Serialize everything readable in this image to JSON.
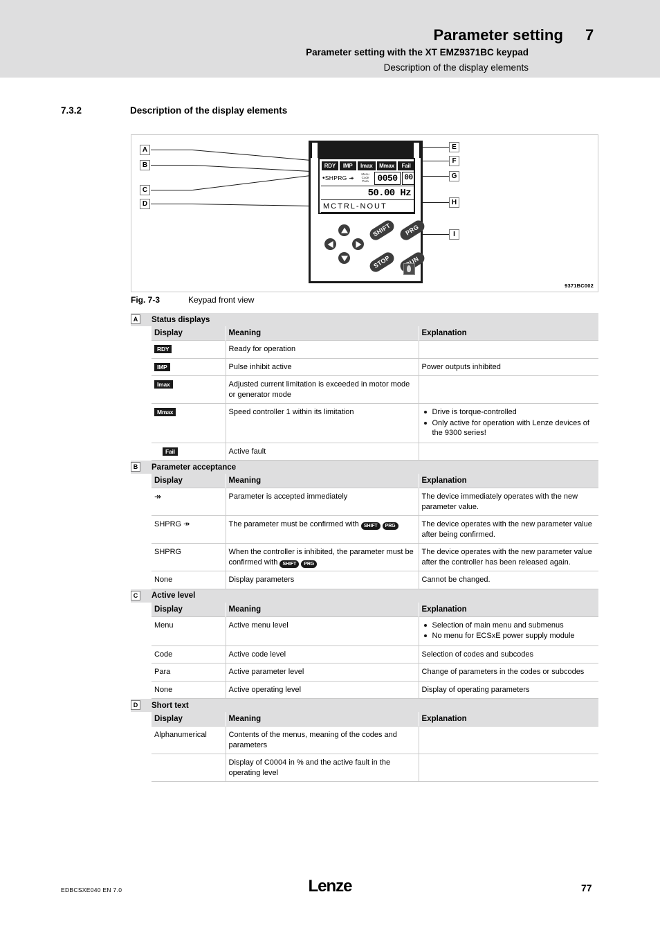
{
  "header": {
    "title": "Parameter setting",
    "chapter": "7",
    "sub1": "Parameter setting with the XT EMZ9371BC keypad",
    "sub2": "Description of the display elements"
  },
  "section": {
    "number": "7.3.2",
    "title": "Description of the display elements"
  },
  "figure": {
    "code": "9371BC002",
    "caption_label": "Fig. 7-3",
    "caption_text": "Keypad front view",
    "callouts": [
      "A",
      "B",
      "C",
      "D",
      "E",
      "F",
      "G",
      "H",
      "I"
    ],
    "keypad": {
      "status_chips": [
        "RDY",
        "IMP",
        "Imax",
        "Mmax",
        "Fail"
      ],
      "param_accept": "SHPRG",
      "param_accept_arrow": "↠",
      "levels": [
        "Menu",
        "Code",
        "Para"
      ],
      "code_value": "0050",
      "subcode_value": "00",
      "value": "50.00",
      "unit": "Hz",
      "short_text": "MCTRL-NOUT",
      "keys": [
        "SHIFT",
        "PRG",
        "STOP",
        "RUN"
      ],
      "arrow_keys": [
        "up",
        "down",
        "left",
        "right"
      ]
    }
  },
  "tables": [
    {
      "marker": "A",
      "title": "Status displays",
      "columns": [
        "Display",
        "Meaning",
        "Explanation"
      ],
      "rows": [
        {
          "display_badge": "RDY",
          "meaning": "Ready for operation",
          "explanation": ""
        },
        {
          "display_badge": "IMP",
          "meaning": "Pulse inhibit active",
          "explanation": "Power outputs inhibited"
        },
        {
          "display_badge": "Imax",
          "meaning": "Adjusted current limitation is exceeded in motor mode or generator mode",
          "explanation": ""
        },
        {
          "display_badge": "Mmax",
          "meaning": "Speed controller 1 within its limitation",
          "explanation_bullets": [
            "Drive is torque-controlled",
            "Only active for operation with Lenze devices of the 9300 series!"
          ]
        },
        {
          "display_badge": "Fail",
          "badge_indent": true,
          "meaning": "Active fault",
          "explanation": ""
        }
      ]
    },
    {
      "marker": "B",
      "title": "Parameter acceptance",
      "columns": [
        "Display",
        "Meaning",
        "Explanation"
      ],
      "rows": [
        {
          "display": "↠",
          "display_is_symbol": true,
          "meaning": "Parameter is accepted  immediately",
          "explanation": "The device immediately operates with the new parameter value."
        },
        {
          "display": "SHPRG ↠",
          "meaning_prefix": "The parameter must be confirmed with ",
          "meaning_keys": [
            "SHIFT",
            "PRG"
          ],
          "explanation": "The device operates with the new parameter value after being confirmed."
        },
        {
          "display": "SHPRG",
          "meaning_prefix": "When the controller is inhibited, the parameter must be confirmed with ",
          "meaning_keys": [
            "SHIFT",
            "PRG"
          ],
          "explanation": "The device operates with the new parameter value after the controller has been released again."
        },
        {
          "display": "None",
          "meaning": "Display parameters",
          "explanation": "Cannot be changed."
        }
      ]
    },
    {
      "marker": "C",
      "title": "Active level",
      "columns": [
        "Display",
        "Meaning",
        "Explanation"
      ],
      "rows": [
        {
          "display": "Menu",
          "meaning": "Active menu level",
          "explanation_bullets": [
            "Selection of main menu and submenus",
            "No menu for ECSxE power supply module"
          ]
        },
        {
          "display": "Code",
          "meaning": "Active code level",
          "explanation": "Selection of codes and subcodes"
        },
        {
          "display": "Para",
          "meaning": "Active parameter level",
          "explanation": "Change of parameters in the codes or subcodes"
        },
        {
          "display": "None",
          "meaning": "Active operating level",
          "explanation": "Display of operating parameters"
        }
      ]
    },
    {
      "marker": "D",
      "title": "Short text",
      "columns": [
        "Display",
        "Meaning",
        "Explanation"
      ],
      "rows": [
        {
          "display": "Alphanumerical",
          "meaning": "Contents of the menus, meaning of the codes and parameters",
          "explanation": ""
        },
        {
          "display": "",
          "meaning": "Display of C0004 in % and the active fault in the operating level",
          "explanation": ""
        }
      ]
    }
  ],
  "footer": {
    "doc_id": "EDBCSXE040  EN  7.0",
    "logo": "Lenze",
    "page": "77"
  }
}
